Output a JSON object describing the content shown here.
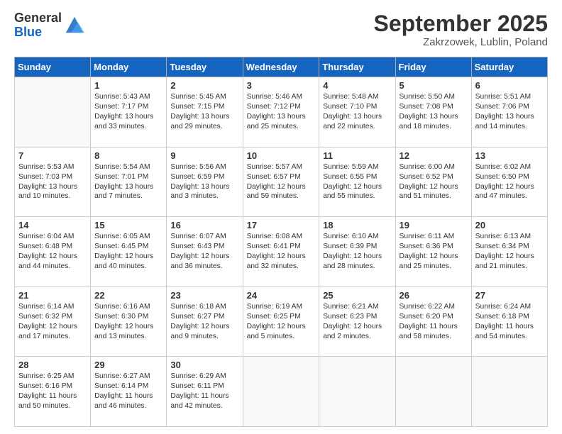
{
  "logo": {
    "general": "General",
    "blue": "Blue"
  },
  "title": "September 2025",
  "subtitle": "Zakrzowek, Lublin, Poland",
  "headers": [
    "Sunday",
    "Monday",
    "Tuesday",
    "Wednesday",
    "Thursday",
    "Friday",
    "Saturday"
  ],
  "weeks": [
    [
      {
        "day": "",
        "info": ""
      },
      {
        "day": "1",
        "info": "Sunrise: 5:43 AM\nSunset: 7:17 PM\nDaylight: 13 hours\nand 33 minutes."
      },
      {
        "day": "2",
        "info": "Sunrise: 5:45 AM\nSunset: 7:15 PM\nDaylight: 13 hours\nand 29 minutes."
      },
      {
        "day": "3",
        "info": "Sunrise: 5:46 AM\nSunset: 7:12 PM\nDaylight: 13 hours\nand 25 minutes."
      },
      {
        "day": "4",
        "info": "Sunrise: 5:48 AM\nSunset: 7:10 PM\nDaylight: 13 hours\nand 22 minutes."
      },
      {
        "day": "5",
        "info": "Sunrise: 5:50 AM\nSunset: 7:08 PM\nDaylight: 13 hours\nand 18 minutes."
      },
      {
        "day": "6",
        "info": "Sunrise: 5:51 AM\nSunset: 7:06 PM\nDaylight: 13 hours\nand 14 minutes."
      }
    ],
    [
      {
        "day": "7",
        "info": "Sunrise: 5:53 AM\nSunset: 7:03 PM\nDaylight: 13 hours\nand 10 minutes."
      },
      {
        "day": "8",
        "info": "Sunrise: 5:54 AM\nSunset: 7:01 PM\nDaylight: 13 hours\nand 7 minutes."
      },
      {
        "day": "9",
        "info": "Sunrise: 5:56 AM\nSunset: 6:59 PM\nDaylight: 13 hours\nand 3 minutes."
      },
      {
        "day": "10",
        "info": "Sunrise: 5:57 AM\nSunset: 6:57 PM\nDaylight: 12 hours\nand 59 minutes."
      },
      {
        "day": "11",
        "info": "Sunrise: 5:59 AM\nSunset: 6:55 PM\nDaylight: 12 hours\nand 55 minutes."
      },
      {
        "day": "12",
        "info": "Sunrise: 6:00 AM\nSunset: 6:52 PM\nDaylight: 12 hours\nand 51 minutes."
      },
      {
        "day": "13",
        "info": "Sunrise: 6:02 AM\nSunset: 6:50 PM\nDaylight: 12 hours\nand 47 minutes."
      }
    ],
    [
      {
        "day": "14",
        "info": "Sunrise: 6:04 AM\nSunset: 6:48 PM\nDaylight: 12 hours\nand 44 minutes."
      },
      {
        "day": "15",
        "info": "Sunrise: 6:05 AM\nSunset: 6:45 PM\nDaylight: 12 hours\nand 40 minutes."
      },
      {
        "day": "16",
        "info": "Sunrise: 6:07 AM\nSunset: 6:43 PM\nDaylight: 12 hours\nand 36 minutes."
      },
      {
        "day": "17",
        "info": "Sunrise: 6:08 AM\nSunset: 6:41 PM\nDaylight: 12 hours\nand 32 minutes."
      },
      {
        "day": "18",
        "info": "Sunrise: 6:10 AM\nSunset: 6:39 PM\nDaylight: 12 hours\nand 28 minutes."
      },
      {
        "day": "19",
        "info": "Sunrise: 6:11 AM\nSunset: 6:36 PM\nDaylight: 12 hours\nand 25 minutes."
      },
      {
        "day": "20",
        "info": "Sunrise: 6:13 AM\nSunset: 6:34 PM\nDaylight: 12 hours\nand 21 minutes."
      }
    ],
    [
      {
        "day": "21",
        "info": "Sunrise: 6:14 AM\nSunset: 6:32 PM\nDaylight: 12 hours\nand 17 minutes."
      },
      {
        "day": "22",
        "info": "Sunrise: 6:16 AM\nSunset: 6:30 PM\nDaylight: 12 hours\nand 13 minutes."
      },
      {
        "day": "23",
        "info": "Sunrise: 6:18 AM\nSunset: 6:27 PM\nDaylight: 12 hours\nand 9 minutes."
      },
      {
        "day": "24",
        "info": "Sunrise: 6:19 AM\nSunset: 6:25 PM\nDaylight: 12 hours\nand 5 minutes."
      },
      {
        "day": "25",
        "info": "Sunrise: 6:21 AM\nSunset: 6:23 PM\nDaylight: 12 hours\nand 2 minutes."
      },
      {
        "day": "26",
        "info": "Sunrise: 6:22 AM\nSunset: 6:20 PM\nDaylight: 11 hours\nand 58 minutes."
      },
      {
        "day": "27",
        "info": "Sunrise: 6:24 AM\nSunset: 6:18 PM\nDaylight: 11 hours\nand 54 minutes."
      }
    ],
    [
      {
        "day": "28",
        "info": "Sunrise: 6:25 AM\nSunset: 6:16 PM\nDaylight: 11 hours\nand 50 minutes."
      },
      {
        "day": "29",
        "info": "Sunrise: 6:27 AM\nSunset: 6:14 PM\nDaylight: 11 hours\nand 46 minutes."
      },
      {
        "day": "30",
        "info": "Sunrise: 6:29 AM\nSunset: 6:11 PM\nDaylight: 11 hours\nand 42 minutes."
      },
      {
        "day": "",
        "info": ""
      },
      {
        "day": "",
        "info": ""
      },
      {
        "day": "",
        "info": ""
      },
      {
        "day": "",
        "info": ""
      }
    ]
  ]
}
